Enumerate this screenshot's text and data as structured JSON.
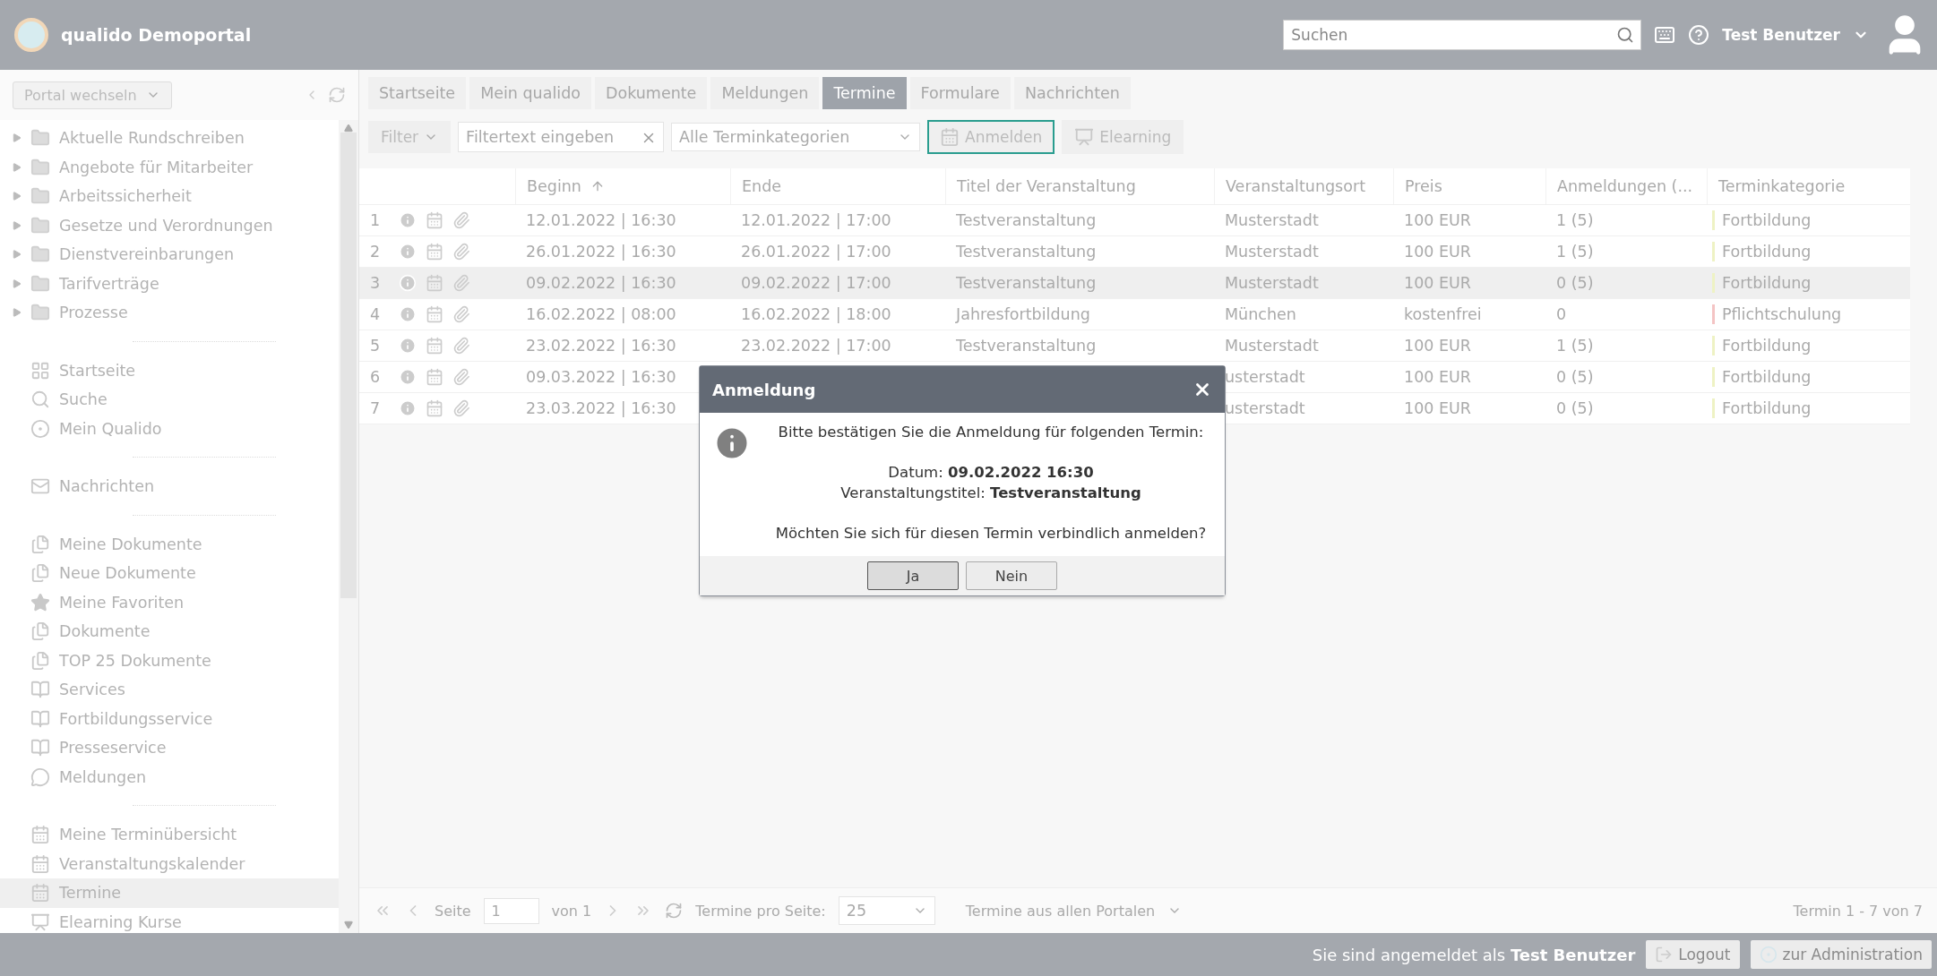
{
  "header": {
    "app_title": "qualido Demoportal",
    "search": {
      "placeholder": "Suchen"
    },
    "user_name": "Test Benutzer"
  },
  "sidebar": {
    "portal_select": "Portal wechseln",
    "tree": [
      {
        "label": "Aktuelle Rundschreiben",
        "expanded": false
      },
      {
        "label": "Angebote für Mitarbeiter",
        "expanded": false
      },
      {
        "label": "Arbeitssicherheit",
        "expanded": false
      },
      {
        "label": "Gesetze und Verordnungen",
        "expanded": false
      },
      {
        "label": "Dienstvereinbarungen",
        "expanded": false
      },
      {
        "label": "Tarifverträge",
        "expanded": false
      },
      {
        "label": "Prozesse",
        "expanded": false
      }
    ],
    "groups": [
      [
        {
          "label": "Startseite",
          "kind": "grid",
          "selected": false
        },
        {
          "label": "Suche",
          "kind": "search",
          "selected": false
        },
        {
          "label": "Mein Qualido",
          "kind": "circles",
          "selected": false
        }
      ],
      [
        {
          "label": "Nachrichten",
          "kind": "mail",
          "selected": false
        }
      ],
      [
        {
          "label": "Meine Dokumente",
          "kind": "docs",
          "selected": false
        },
        {
          "label": "Neue Dokumente",
          "kind": "docs",
          "selected": false
        },
        {
          "label": "Meine Favoriten",
          "kind": "star",
          "selected": false
        },
        {
          "label": "Dokumente",
          "kind": "docs",
          "selected": false
        },
        {
          "label": "TOP 25 Dokumente",
          "kind": "docs",
          "selected": false
        },
        {
          "label": "Services",
          "kind": "book",
          "selected": false
        },
        {
          "label": "Fortbildungsservice",
          "kind": "book",
          "selected": false
        },
        {
          "label": "Presseservice",
          "kind": "book",
          "selected": false
        },
        {
          "label": "Meldungen",
          "kind": "chat",
          "selected": false
        }
      ],
      [
        {
          "label": "Meine Terminübersicht",
          "kind": "calendar",
          "selected": false
        },
        {
          "label": "Veranstaltungskalender",
          "kind": "calendar",
          "selected": false
        },
        {
          "label": "Termine",
          "kind": "calendar",
          "selected": true
        },
        {
          "label": "Elearning Kurse",
          "kind": "teach",
          "selected": false
        }
      ]
    ]
  },
  "tabs": [
    {
      "label": "Startseite",
      "selected": false
    },
    {
      "label": "Mein qualido",
      "selected": false
    },
    {
      "label": "Dokumente",
      "selected": false
    },
    {
      "label": "Meldungen",
      "selected": false
    },
    {
      "label": "Termine",
      "selected": true
    },
    {
      "label": "Formulare",
      "selected": false
    },
    {
      "label": "Nachrichten",
      "selected": false
    }
  ],
  "toolbar": {
    "filter": "Filter",
    "filter_text": {
      "placeholder": "Filtertext eingeben"
    },
    "category": "Alle Terminkategorien",
    "buttons": [
      {
        "label": "Anmelden",
        "kind": "calendar",
        "focused": true
      },
      {
        "label": "Elearning",
        "kind": "teach",
        "focused": false
      }
    ]
  },
  "table": {
    "columns": [
      "Beginn",
      "Ende",
      "Titel der Veranstaltung",
      "Veranstaltungsort",
      "Preis",
      "Anmeldungen (...",
      "Terminkategorie"
    ],
    "rows": [
      {
        "number": "1",
        "begin": "12.01.2022 | 16:30",
        "end": "12.01.2022 | 17:00",
        "title": "Testveranstaltung",
        "place": "Musterstadt",
        "price": "100 EUR",
        "registrations": "1 (5)",
        "category": "Fortbildung",
        "color": "#eef2c4",
        "selected": false
      },
      {
        "number": "2",
        "begin": "26.01.2022 | 16:30",
        "end": "26.01.2022 | 17:00",
        "title": "Testveranstaltung",
        "place": "Musterstadt",
        "price": "100 EUR",
        "registrations": "1 (5)",
        "category": "Fortbildung",
        "color": "#eef2c4",
        "selected": false
      },
      {
        "number": "3",
        "begin": "09.02.2022 | 16:30",
        "end": "09.02.2022 | 17:00",
        "title": "Testveranstaltung",
        "place": "Musterstadt",
        "price": "100 EUR",
        "registrations": "0 (5)",
        "category": "Fortbildung",
        "color": "#eef2c4",
        "selected": true
      },
      {
        "number": "4",
        "begin": "16.02.2022 | 08:00",
        "end": "16.02.2022 | 18:00",
        "title": "Jahresfortbildung",
        "place": "München",
        "price": "kostenfrei",
        "registrations": "0",
        "category": "Pflichtschulung",
        "color": "#f4c4c4",
        "selected": false
      },
      {
        "number": "5",
        "begin": "23.02.2022 | 16:30",
        "end": "23.02.2022 | 17:00",
        "title": "Testveranstaltung",
        "place": "Musterstadt",
        "price": "100 EUR",
        "registrations": "1 (5)",
        "category": "Fortbildung",
        "color": "#eef2c4",
        "selected": false
      },
      {
        "number": "6",
        "begin": "09.03.2022 | 16:30",
        "end": "",
        "title": "",
        "place": "usterstadt",
        "price": "100 EUR",
        "registrations": "0 (5)",
        "category": "Fortbildung",
        "color": "#eef2c4",
        "selected": false
      },
      {
        "number": "7",
        "begin": "23.03.2022 | 16:30",
        "end": "",
        "title": "",
        "place": "usterstadt",
        "price": "100 EUR",
        "registrations": "0 (5)",
        "category": "Fortbildung",
        "color": "#eef2c4",
        "selected": false
      }
    ]
  },
  "pager": {
    "page_label": "Seite",
    "page": "1",
    "of": "von 1",
    "per_page_label": "Termine pro Seite:",
    "per_page": "25",
    "scope": "Termine aus allen Portalen",
    "summary": "Termin 1 - 7 von 7"
  },
  "status_bar": {
    "logged_in": "Sie sind angemeldet als **Test Benutzer**",
    "logout": "Logout",
    "admin": "zur Administration"
  },
  "dialog": {
    "title": "Anmeldung",
    "message": "Bitte bestätigen Sie die Anmeldung für folgenden Termin:",
    "date": "Datum: **09.02.2022 16:30**",
    "event": "Veranstaltungstitel: **Testveranstaltung**",
    "question": "Möchten Sie sich für diesen Termin verbindlich anmelden?",
    "buttons": [
      {
        "label": "Ja",
        "default": true
      },
      {
        "label": "Nein",
        "default": false
      }
    ]
  }
}
